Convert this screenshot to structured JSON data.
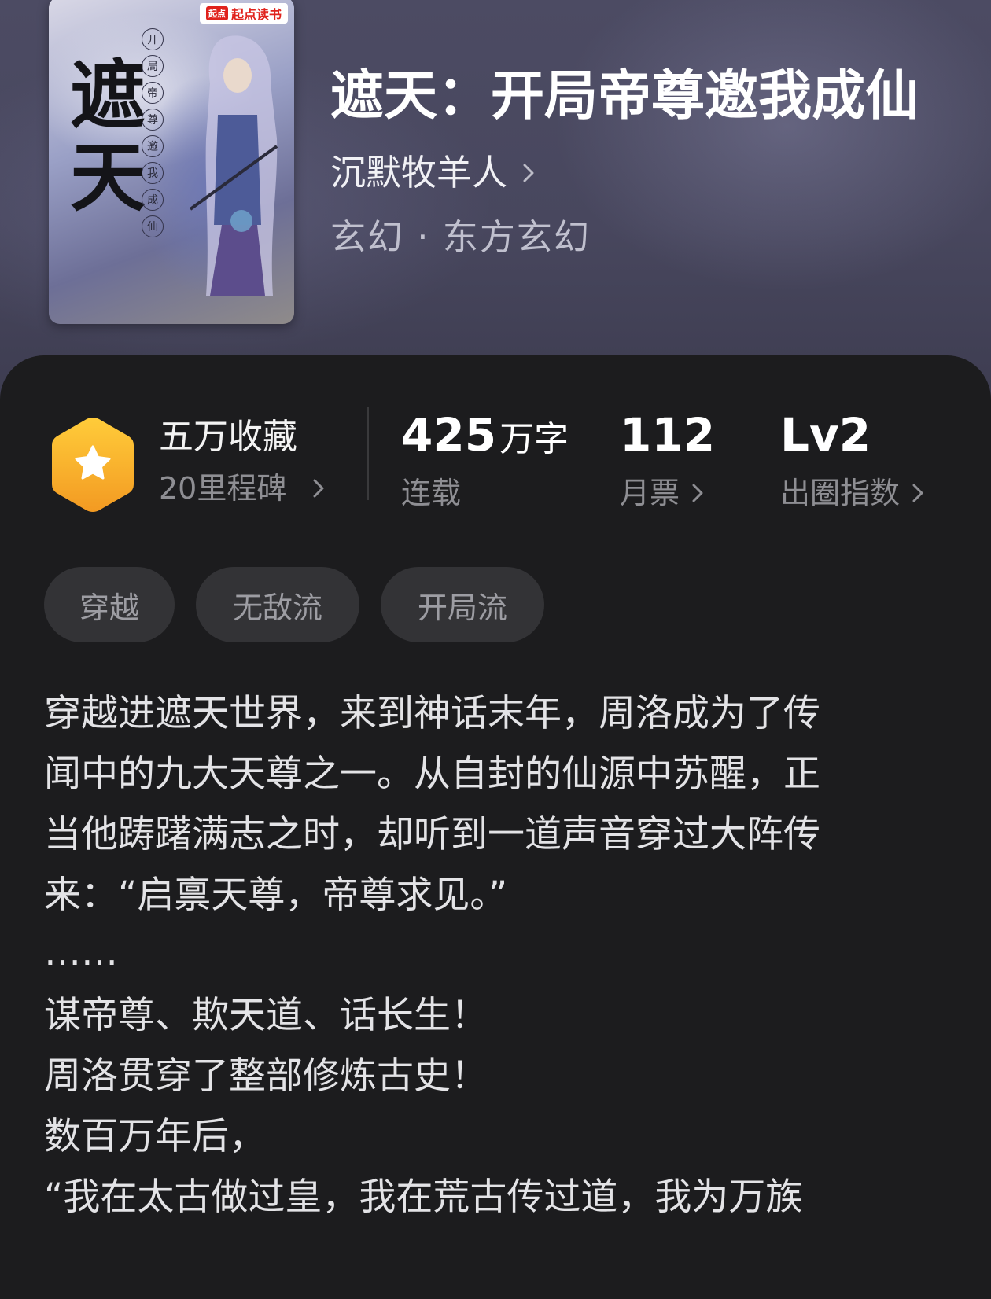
{
  "book": {
    "title": "遮天：开局帝尊邀我成仙",
    "author": "沉默牧羊人",
    "genre": "玄幻 · 东方玄幻",
    "cover": {
      "badge_mark": "起点",
      "badge_text": "起点读书",
      "big_chars": [
        "遮",
        "天"
      ],
      "vertical_chars": [
        "开",
        "局",
        "帝",
        "尊",
        "邀",
        "我",
        "成",
        "仙"
      ]
    }
  },
  "stats": {
    "collection": {
      "title": "五万收藏",
      "sub": "20里程碑"
    },
    "words": {
      "value": "425",
      "unit": "万字",
      "label": "连载"
    },
    "monthly_ticket": {
      "value": "112",
      "label": "月票"
    },
    "popularity": {
      "value": "Lv2",
      "label": "出圈指数"
    }
  },
  "tags": [
    "穿越",
    "无敌流",
    "开局流"
  ],
  "description": [
    "穿越进遮天世界，来到神话末年，周洛成为了传",
    "闻中的九大天尊之一。从自封的仙源中苏醒，正",
    "当他踌躇满志之时，却听到一道声音穿过大阵传",
    "来：“启禀天尊，帝尊求见。”",
    "……",
    "谋帝尊、欺天道、话长生！",
    "周洛贯穿了整部修炼古史！",
    "数百万年后，",
    "“我在太古做过皇，我在荒古传过道，我为万族"
  ],
  "colors": {
    "header_bg": "#4c4b63",
    "panel_bg": "#1c1c1e",
    "badge_gold": "#f7a52c",
    "tag_bg": "#333336"
  },
  "icons": {
    "badge": "star-hexagon-icon",
    "chevron": "chevron-right-icon"
  }
}
